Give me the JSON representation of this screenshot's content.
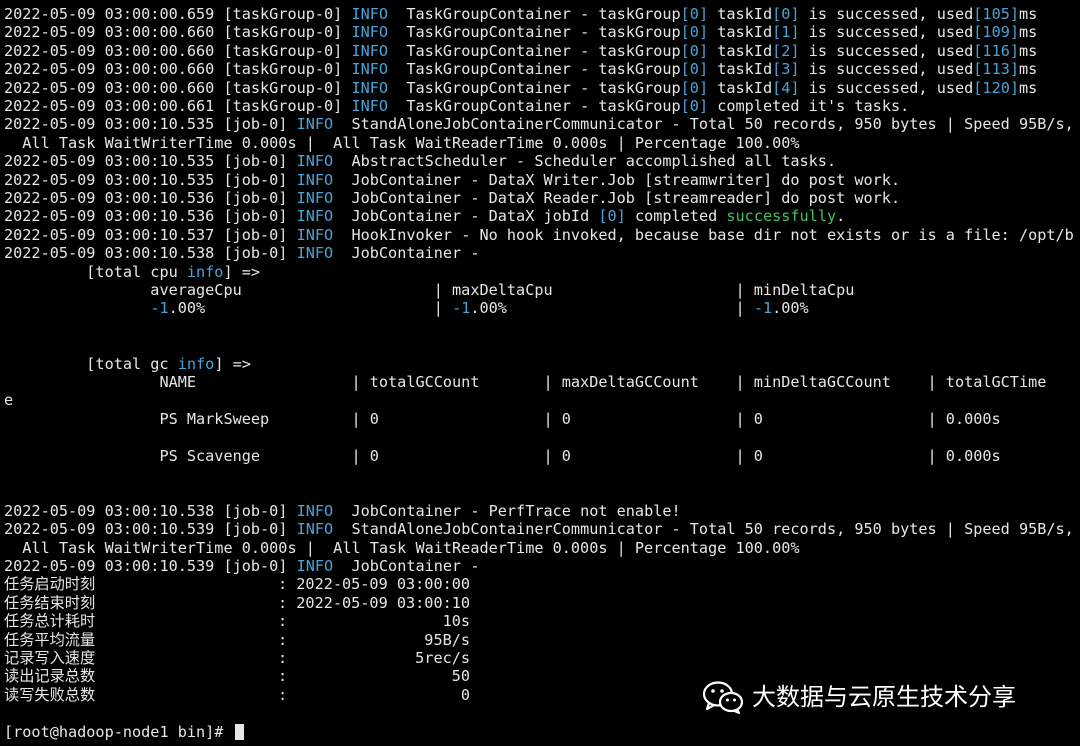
{
  "terminal": {
    "lines": [
      [
        {
          "t": "2022-05-09 03:00:00.659 [taskGroup-0] "
        },
        {
          "t": "INFO",
          "c": "c"
        },
        {
          "t": "  TaskGroupContainer - taskGroup"
        },
        {
          "t": "[0]",
          "c": "c"
        },
        {
          "t": " taskId"
        },
        {
          "t": "[0]",
          "c": "c"
        },
        {
          "t": " is successed, used"
        },
        {
          "t": "[105]",
          "c": "c"
        },
        {
          "t": "ms"
        }
      ],
      [
        {
          "t": "2022-05-09 03:00:00.660 [taskGroup-0] "
        },
        {
          "t": "INFO",
          "c": "c"
        },
        {
          "t": "  TaskGroupContainer - taskGroup"
        },
        {
          "t": "[0]",
          "c": "c"
        },
        {
          "t": " taskId"
        },
        {
          "t": "[1]",
          "c": "c"
        },
        {
          "t": " is successed, used"
        },
        {
          "t": "[109]",
          "c": "c"
        },
        {
          "t": "ms"
        }
      ],
      [
        {
          "t": "2022-05-09 03:00:00.660 [taskGroup-0] "
        },
        {
          "t": "INFO",
          "c": "c"
        },
        {
          "t": "  TaskGroupContainer - taskGroup"
        },
        {
          "t": "[0]",
          "c": "c"
        },
        {
          "t": " taskId"
        },
        {
          "t": "[2]",
          "c": "c"
        },
        {
          "t": " is successed, used"
        },
        {
          "t": "[116]",
          "c": "c"
        },
        {
          "t": "ms"
        }
      ],
      [
        {
          "t": "2022-05-09 03:00:00.660 [taskGroup-0] "
        },
        {
          "t": "INFO",
          "c": "c"
        },
        {
          "t": "  TaskGroupContainer - taskGroup"
        },
        {
          "t": "[0]",
          "c": "c"
        },
        {
          "t": " taskId"
        },
        {
          "t": "[3]",
          "c": "c"
        },
        {
          "t": " is successed, used"
        },
        {
          "t": "[113]",
          "c": "c"
        },
        {
          "t": "ms"
        }
      ],
      [
        {
          "t": "2022-05-09 03:00:00.660 [taskGroup-0] "
        },
        {
          "t": "INFO",
          "c": "c"
        },
        {
          "t": "  TaskGroupContainer - taskGroup"
        },
        {
          "t": "[0]",
          "c": "c"
        },
        {
          "t": " taskId"
        },
        {
          "t": "[4]",
          "c": "c"
        },
        {
          "t": " is successed, used"
        },
        {
          "t": "[120]",
          "c": "c"
        },
        {
          "t": "ms"
        }
      ],
      [
        {
          "t": "2022-05-09 03:00:00.661 [taskGroup-0] "
        },
        {
          "t": "INFO",
          "c": "c"
        },
        {
          "t": "  TaskGroupContainer - taskGroup"
        },
        {
          "t": "[0]",
          "c": "c"
        },
        {
          "t": " completed it's tasks."
        }
      ],
      [
        {
          "t": "2022-05-09 03:00:10.535 [job-0] "
        },
        {
          "t": "INFO",
          "c": "c"
        },
        {
          "t": "  StandAloneJobContainerCommunicator - Total 50 records, 950 bytes | Speed 95B/s,"
        }
      ],
      [
        {
          "t": "  All Task WaitWriterTime 0.000s |  All Task WaitReaderTime 0.000s | Percentage 100.00%"
        }
      ],
      [
        {
          "t": "2022-05-09 03:00:10.535 [job-0] "
        },
        {
          "t": "INFO",
          "c": "c"
        },
        {
          "t": "  AbstractScheduler - Scheduler accomplished all tasks."
        }
      ],
      [
        {
          "t": "2022-05-09 03:00:10.535 [job-0] "
        },
        {
          "t": "INFO",
          "c": "c"
        },
        {
          "t": "  JobContainer - DataX Writer.Job [streamwriter] do post work."
        }
      ],
      [
        {
          "t": "2022-05-09 03:00:10.536 [job-0] "
        },
        {
          "t": "INFO",
          "c": "c"
        },
        {
          "t": "  JobContainer - DataX Reader.Job [streamreader] do post work."
        }
      ],
      [
        {
          "t": "2022-05-09 03:00:10.536 [job-0] "
        },
        {
          "t": "INFO",
          "c": "c"
        },
        {
          "t": "  JobContainer - DataX jobId "
        },
        {
          "t": "[0]",
          "c": "c"
        },
        {
          "t": " completed "
        },
        {
          "t": "successfully",
          "c": "g"
        },
        {
          "t": "."
        }
      ],
      [
        {
          "t": "2022-05-09 03:00:10.537 [job-0] "
        },
        {
          "t": "INFO",
          "c": "c"
        },
        {
          "t": "  HookInvoker - No hook invoked, because base dir not exists or is a file: /opt/b"
        }
      ],
      [
        {
          "t": "2022-05-09 03:00:10.538 [job-0] "
        },
        {
          "t": "INFO",
          "c": "c"
        },
        {
          "t": "  JobContainer -"
        }
      ],
      [
        {
          "t": "         [total cpu "
        },
        {
          "t": "info",
          "c": "c"
        },
        {
          "t": "] =>"
        }
      ],
      [
        {
          "t": "                averageCpu                     | maxDeltaCpu                    | minDeltaCpu"
        }
      ],
      [
        {
          "t": "                "
        },
        {
          "t": "-1",
          "c": "c"
        },
        {
          "t": ".00%                         | "
        },
        {
          "t": "-1",
          "c": "c"
        },
        {
          "t": ".00%                         | "
        },
        {
          "t": "-1",
          "c": "c"
        },
        {
          "t": ".00%"
        }
      ],
      [
        {
          "t": ""
        }
      ],
      [
        {
          "t": ""
        }
      ],
      [
        {
          "t": "         [total gc "
        },
        {
          "t": "info",
          "c": "c"
        },
        {
          "t": "] =>"
        }
      ],
      [
        {
          "t": "                 NAME                 | totalGCCount       | maxDeltaGCCount    | minDeltaGCCount    | totalGCTime"
        }
      ],
      [
        {
          "t": "e"
        }
      ],
      [
        {
          "t": "                 PS MarkSweep         | 0                  | 0                  | 0                  | 0.000s"
        }
      ],
      [
        {
          "t": ""
        }
      ],
      [
        {
          "t": "                 PS Scavenge          | 0                  | 0                  | 0                  | 0.000s"
        }
      ],
      [
        {
          "t": ""
        }
      ],
      [
        {
          "t": ""
        }
      ],
      [
        {
          "t": "2022-05-09 03:00:10.538 [job-0] "
        },
        {
          "t": "INFO",
          "c": "c"
        },
        {
          "t": "  JobContainer - PerfTrace not enable!"
        }
      ],
      [
        {
          "t": "2022-05-09 03:00:10.539 [job-0] "
        },
        {
          "t": "INFO",
          "c": "c"
        },
        {
          "t": "  StandAloneJobContainerCommunicator - Total 50 records, 950 bytes | Speed 95B/s,"
        }
      ],
      [
        {
          "t": "  All Task WaitWriterTime 0.000s |  All Task WaitReaderTime 0.000s | Percentage 100.00%"
        }
      ],
      [
        {
          "t": "2022-05-09 03:00:10.539 [job-0] "
        },
        {
          "t": "INFO",
          "c": "c"
        },
        {
          "t": "  JobContainer -"
        }
      ],
      [
        {
          "t": "任务启动时刻                    : 2022-05-09 03:00:00"
        }
      ],
      [
        {
          "t": "任务结束时刻                    : 2022-05-09 03:00:10"
        }
      ],
      [
        {
          "t": "任务总计耗时                    :                 10s"
        }
      ],
      [
        {
          "t": "任务平均流量                    :               95B/s"
        }
      ],
      [
        {
          "t": "记录写入速度                    :              5rec/s"
        }
      ],
      [
        {
          "t": "读出记录总数                    :                  50"
        }
      ],
      [
        {
          "t": "读写失败总数                    :                   0"
        }
      ],
      [
        {
          "t": ""
        }
      ],
      [
        {
          "t": "[root@hadoop-node1 bin]# "
        }
      ]
    ]
  },
  "watermark": {
    "icon": "wechat-icon",
    "text": "大数据与云原生技术分享"
  },
  "colors": {
    "background": "#000000",
    "text": "#e6e6e6",
    "info": "#4aa3d6",
    "success": "#43c35a"
  }
}
